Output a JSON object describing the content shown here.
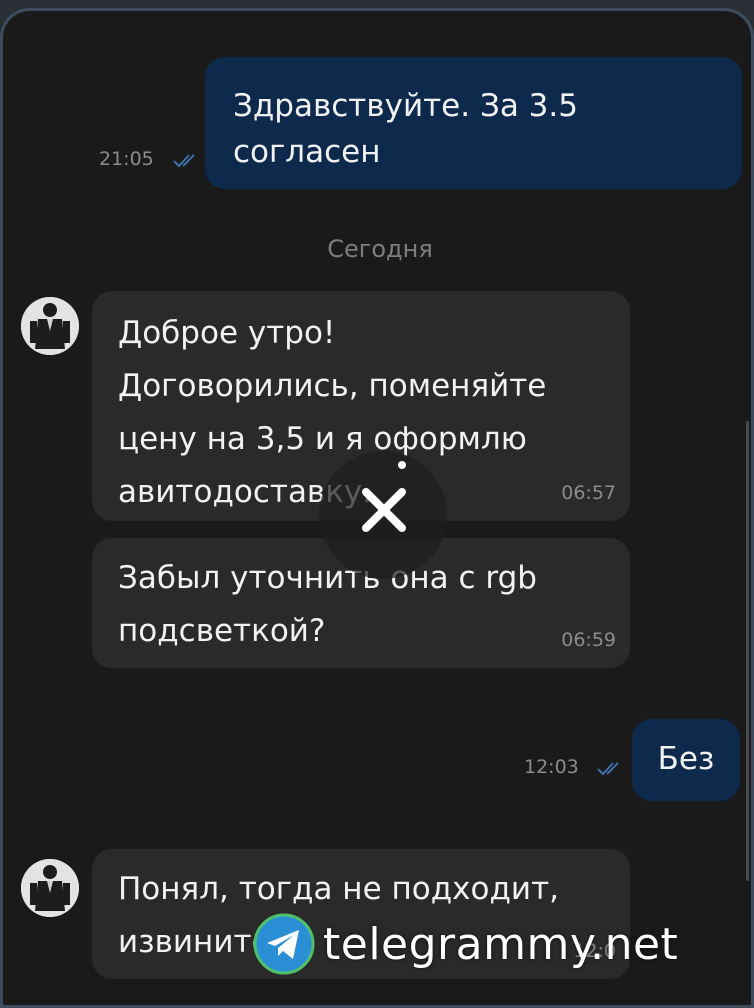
{
  "colors": {
    "chat_background": "#1a1a1a",
    "outgoing_bubble": "#0d2a4d",
    "incoming_bubble": "#2a2a2a",
    "timestamp": "#8c8c8c",
    "read_ticks": "#3e6fa8"
  },
  "messages": [
    {
      "direction": "outgoing",
      "text": "Здравствуйте. За 3.5\nсогласен",
      "time": "21:05",
      "read": true
    },
    {
      "direction": "incoming",
      "text": "Доброе утро!\nДоговорились, поменяйте\nцену на 3,5 и я оформлю\nавитодоставку.",
      "time": "06:57",
      "avatar": true
    },
    {
      "direction": "incoming",
      "text": "Забыл уточнить она с rgb\nподсветкой?",
      "time": "06:59"
    },
    {
      "direction": "outgoing",
      "text": "Без",
      "time": "12:03",
      "read": true
    },
    {
      "direction": "incoming",
      "text": "Понял, тогда не подходит,\nизвините",
      "time": "12:0",
      "avatar": true
    }
  ],
  "day_separator": "Сегодня",
  "overlay": {
    "close_icon": "close-icon"
  },
  "watermark": {
    "text": "telegrammy.net",
    "icon": "telegram-logo"
  }
}
